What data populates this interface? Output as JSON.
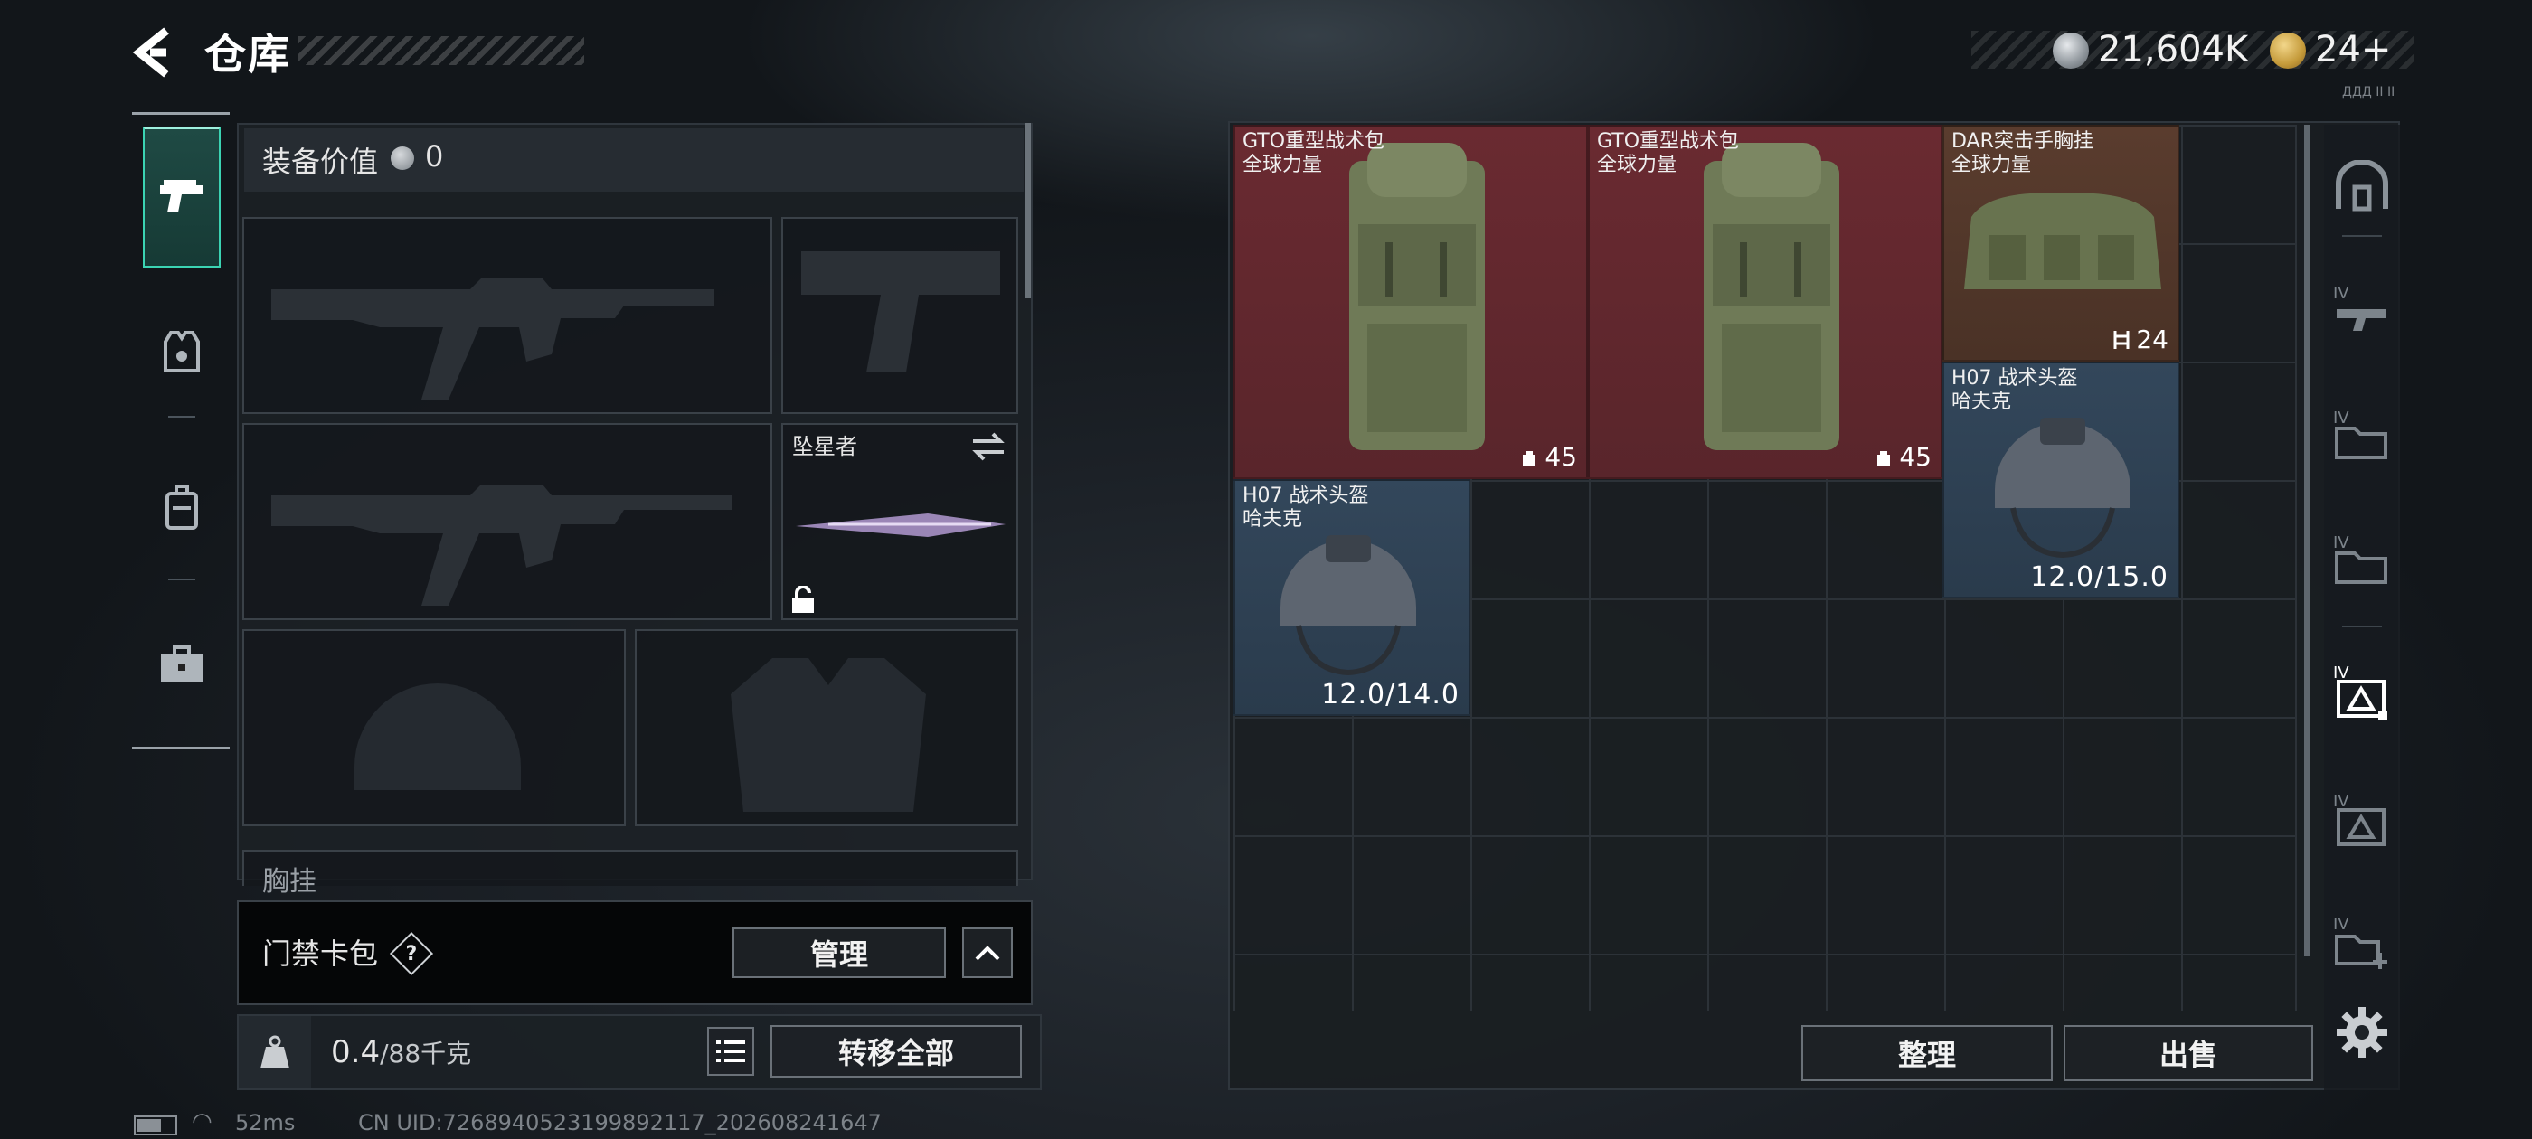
{
  "header": {
    "title": "仓库",
    "currency_1": "21,604K",
    "currency_2": "24+",
    "version": "ДДД ІІ ІІ"
  },
  "equipment": {
    "value_label": "装备价值",
    "value": "0",
    "knife_name": "坠星者",
    "chest_label": "胸挂",
    "chest_help": "?"
  },
  "card_pack": {
    "label": "门禁卡包",
    "help": "?",
    "manage_label": "管理"
  },
  "weight": {
    "current": "0.4",
    "max": "/88千克",
    "transfer_all_label": "转移全部"
  },
  "status": {
    "ping": "52ms",
    "uid": "CN UID:7268940523199892117_202608241647"
  },
  "storage": {
    "items": [
      {
        "name": "GTO重型战术包\n全球力量",
        "qty": "45",
        "color": "#6a2a31"
      },
      {
        "name": "GTO重型战术包\n全球力量",
        "qty": "45",
        "color": "#6a2a31"
      },
      {
        "name": "DAR突击手胸挂\n全球力量",
        "qty": "24",
        "color": "#5a3c2e"
      },
      {
        "name": "H07 战术头盔\n哈夫克",
        "durability": "12.0/15.0",
        "color": "#33475b"
      },
      {
        "name": "H07 战术头盔\n哈夫克",
        "durability": "12.0/14.0",
        "color": "#33475b"
      }
    ],
    "sort_label": "整理",
    "sell_label": "出售"
  },
  "sidebar_right": {
    "tier_labels": [
      "IV",
      "IV",
      "IV",
      "IV",
      "IV",
      "IV"
    ]
  }
}
